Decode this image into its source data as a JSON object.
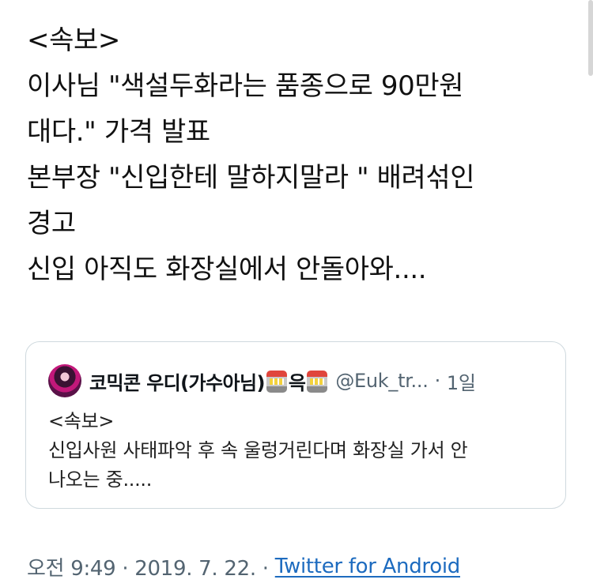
{
  "tweet": {
    "lines": [
      "<속보>",
      "이사님 \"색설두화라는 품종으로 90만원",
      "대다.\" 가격 발표",
      "본부장 \"신입한테 말하지말라 \" 배려섞인",
      "경고",
      "신입 아직도 화장실에서 안돌아와...."
    ]
  },
  "quote": {
    "author_name": "코믹콘 우디(가수아님)",
    "author_middle": "윽",
    "author_emoji": "slot-machine-icon",
    "handle": "@Euk_tr...",
    "separator": "·",
    "time": "1일",
    "lines": [
      "<속보>",
      "신입사원 사태파악 후 속 울렁거린다며 화장실 가서 안",
      "나오는 중....."
    ]
  },
  "footer": {
    "timestamp": "오전 9:49 · 2019. 7. 22. ·",
    "source": "Twitter for Android"
  },
  "colors": {
    "link": "#1d6bbf",
    "muted": "#536471",
    "border": "#cfd9de"
  }
}
